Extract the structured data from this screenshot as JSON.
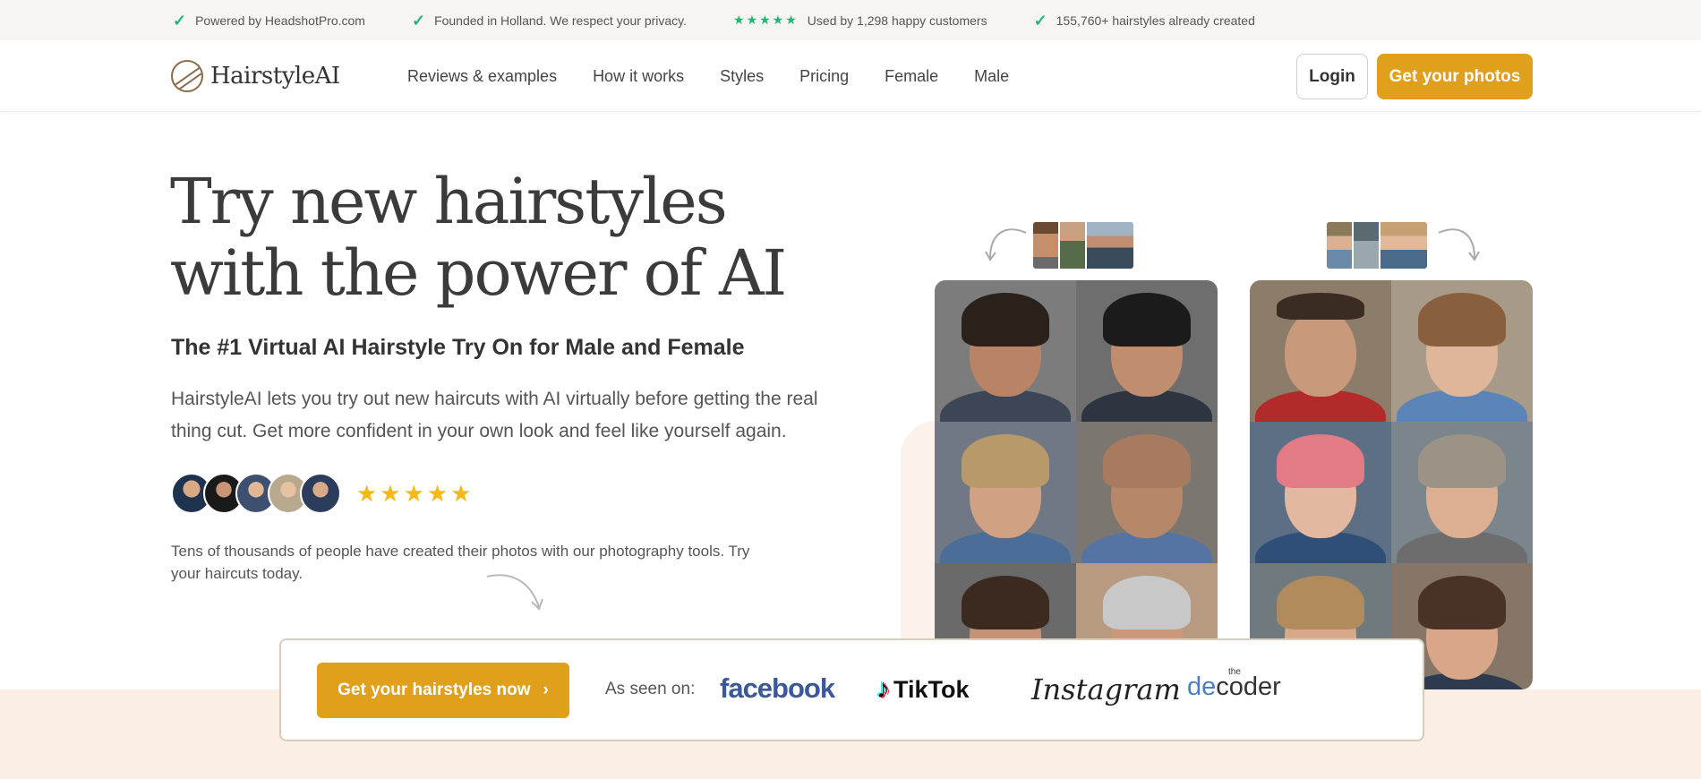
{
  "topbar": {
    "items": [
      "Powered by HeadshotPro.com",
      "Founded in Holland. We respect your privacy.",
      "Used by 1,298 happy customers",
      "155,760+ hairstyles already created"
    ],
    "stars": "★★★★★"
  },
  "header": {
    "logo_text": "HairstyleAI",
    "nav": [
      "Reviews & examples",
      "How it works",
      "Styles",
      "Pricing",
      "Female",
      "Male"
    ],
    "login_label": "Login",
    "cta_label": "Get your photos"
  },
  "hero": {
    "title_line1": "Try new hairstyles",
    "title_line2": "with the power of AI",
    "subtitle": "The #1 Virtual AI Hairstyle Try On for Male and Female",
    "description": "HairstyleAI lets you try out new haircuts with AI virtually before getting the real thing cut. Get more confident in your own look and feel like yourself again.",
    "rating_stars": "★★★★★",
    "social_proof": "Tens of thousands of people have created their photos with our photography tools. Try your haircuts today."
  },
  "seen_on": {
    "cta_label": "Get your hairstyles now",
    "cta_chevron": "›",
    "label": "As seen on:",
    "logos": {
      "facebook": "facebook",
      "tiktok": "TikTok",
      "instagram": "Instagram",
      "decoder_the": "the",
      "decoder_de": "de",
      "decoder_rest": "coder"
    }
  },
  "colors": {
    "accent": "#e0a01c",
    "check_green": "#22b573",
    "star_yellow": "#f5b814",
    "band": "#fbeee4"
  },
  "icons": {
    "topbar_check": "check-icon",
    "logo": "hairstyleai-leaf-logo",
    "cta_chevron": "chevron-right-icon"
  }
}
